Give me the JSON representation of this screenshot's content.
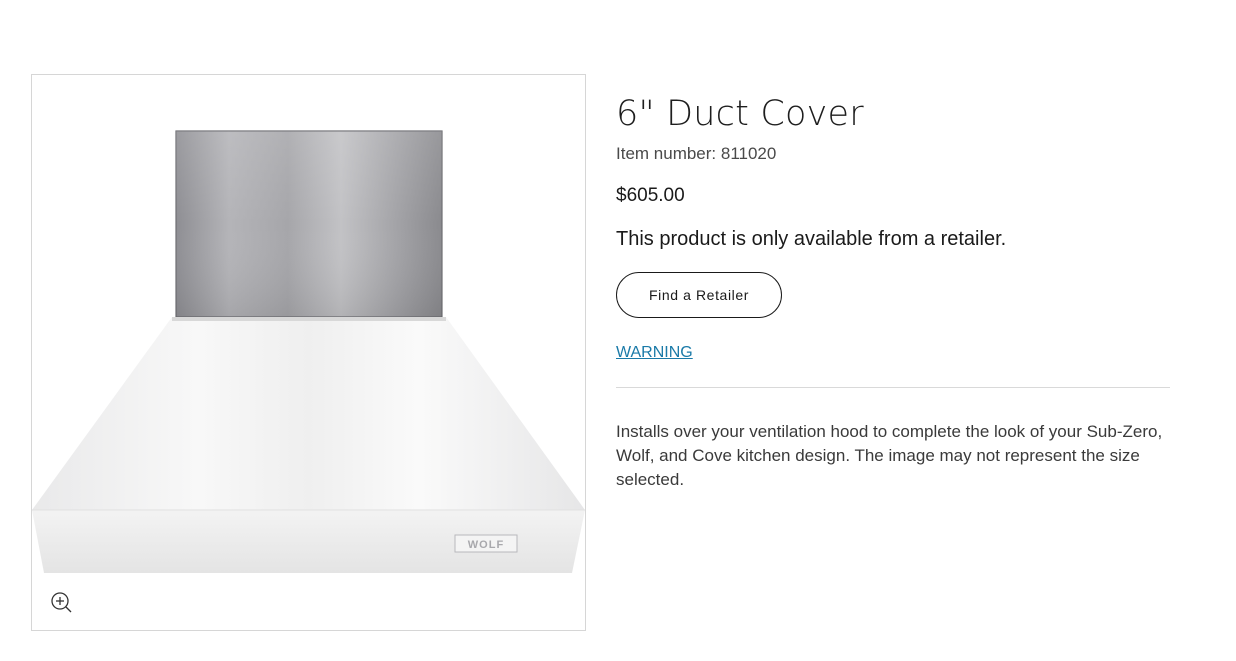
{
  "product": {
    "title": "6\" Duct Cover",
    "item_number": "Item number: 811020",
    "price": "$605.00",
    "availability": "This product is only available from a retailer.",
    "find_retailer_label": "Find a Retailer",
    "warning_label": "WARNING",
    "description": "Installs over your ventilation hood to complete the look of your Sub-Zero, Wolf, and Cove kitchen design. The image may not represent the size selected.",
    "image_brand_mark": "WOLF"
  },
  "colors": {
    "link": "#1a7aa8",
    "text": "#1a1a1a",
    "border": "#d6d6d6"
  },
  "icons": {
    "zoom": "zoom-in-icon"
  }
}
